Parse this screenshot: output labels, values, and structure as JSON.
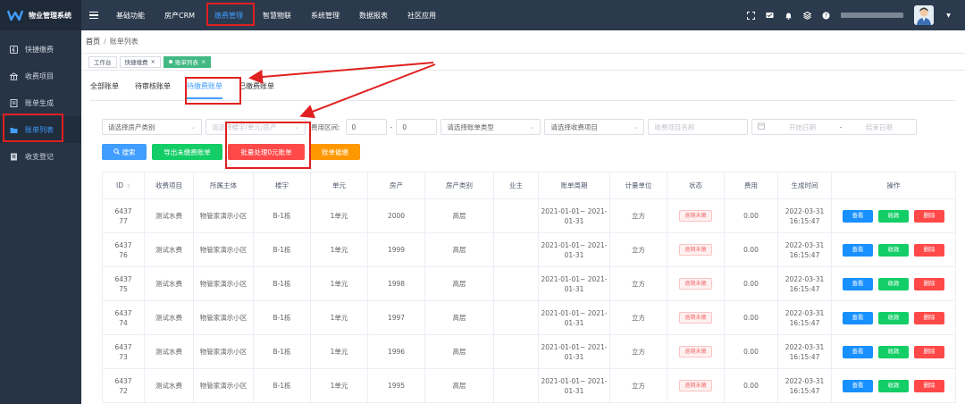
{
  "app": {
    "title": "物业管理系统",
    "brand_color": "#409eff"
  },
  "sidebar": {
    "items": [
      {
        "label": "快捷缴费",
        "icon": "lightning-icon"
      },
      {
        "label": "收费项目",
        "icon": "bank-icon"
      },
      {
        "label": "账单生成",
        "icon": "document-icon"
      },
      {
        "label": "账单列表",
        "icon": "folder-icon",
        "active": true
      },
      {
        "label": "收支登记",
        "icon": "ledger-icon"
      }
    ]
  },
  "topnav": {
    "items": [
      "基础功能",
      "房产CRM",
      "缴费管理",
      "智慧物联",
      "系统管理",
      "数据报表",
      "社区应用"
    ],
    "active_index": 2
  },
  "breadcrumb": {
    "home": "首页",
    "separator": "/",
    "current": "账单列表"
  },
  "tags": {
    "items": [
      {
        "label": "工作台",
        "closable": false
      },
      {
        "label": "快捷缴费",
        "closable": true,
        "close": "×"
      },
      {
        "label": "账单列表",
        "closable": true,
        "active": true,
        "close": "×"
      }
    ]
  },
  "tabs": {
    "items": [
      "全部账单",
      "待审核账单",
      "待缴费账单",
      "已缴费账单"
    ],
    "active_index": 2
  },
  "filters": {
    "house_type_placeholder": "请选择房产类别",
    "building_placeholder": "请选择楼宇/单元/房产",
    "fee_range_label": "费用区间:",
    "fee_min": "0",
    "range_dash": "-",
    "fee_max": "0",
    "bill_type_placeholder": "请选择账单类型",
    "fee_item_placeholder": "请选择收费项目",
    "fee_name_placeholder": "收费项目名称",
    "start_date_placeholder": "开始日期",
    "date_dash": "-",
    "end_date_placeholder": "结束日期"
  },
  "actions": {
    "search": "搜索",
    "export": "导出未缴费账单",
    "batch": "批量处理0元账单",
    "remind": "账单催缴"
  },
  "table": {
    "columns": [
      "ID",
      "收费项目",
      "所属主体",
      "楼宇",
      "单元",
      "房产",
      "房产类别",
      "业主",
      "账单周期",
      "计量单位",
      "状态",
      "费用",
      "生成时间",
      "操作"
    ],
    "op_labels": {
      "view": "查看",
      "collect": "收款",
      "delete": "删除"
    },
    "rows": [
      {
        "id": "643777",
        "item": "测试水费",
        "subject": "物管家演示小区",
        "building": "B-1栋",
        "unit": "1单元",
        "house": "2000",
        "type": "高层",
        "owner": "",
        "period": "2021-01-01~ 2021-01-31",
        "measure": "立方",
        "status": "逾期未缴",
        "fee": "0.00",
        "time": "2022-03-31 16:15:47"
      },
      {
        "id": "643776",
        "item": "测试水费",
        "subject": "物管家演示小区",
        "building": "B-1栋",
        "unit": "1单元",
        "house": "1999",
        "type": "高层",
        "owner": "",
        "period": "2021-01-01~ 2021-01-31",
        "measure": "立方",
        "status": "逾期未缴",
        "fee": "0.00",
        "time": "2022-03-31 16:15:47"
      },
      {
        "id": "643775",
        "item": "测试水费",
        "subject": "物管家演示小区",
        "building": "B-1栋",
        "unit": "1单元",
        "house": "1998",
        "type": "高层",
        "owner": "",
        "period": "2021-01-01~ 2021-01-31",
        "measure": "立方",
        "status": "逾期未缴",
        "fee": "0.00",
        "time": "2022-03-31 16:15:47"
      },
      {
        "id": "643774",
        "item": "测试水费",
        "subject": "物管家演示小区",
        "building": "B-1栋",
        "unit": "1单元",
        "house": "1997",
        "type": "高层",
        "owner": "",
        "period": "2021-01-01~ 2021-01-31",
        "measure": "立方",
        "status": "逾期未缴",
        "fee": "0.00",
        "time": "2022-03-31 16:15:47"
      },
      {
        "id": "643773",
        "item": "测试水费",
        "subject": "物管家演示小区",
        "building": "B-1栋",
        "unit": "1单元",
        "house": "1996",
        "type": "高层",
        "owner": "",
        "period": "2021-01-01~ 2021-01-31",
        "measure": "立方",
        "status": "逾期未缴",
        "fee": "0.00",
        "time": "2022-03-31 16:15:47"
      },
      {
        "id": "643772",
        "item": "测试水费",
        "subject": "物管家演示小区",
        "building": "B-1栋",
        "unit": "1单元",
        "house": "1995",
        "type": "高层",
        "owner": "",
        "period": "2021-01-01~ 2021-01-31",
        "measure": "立方",
        "status": "逾期未缴",
        "fee": "0.00",
        "time": "2022-03-31 16:15:47"
      }
    ]
  },
  "annotation_color": "#e02020"
}
